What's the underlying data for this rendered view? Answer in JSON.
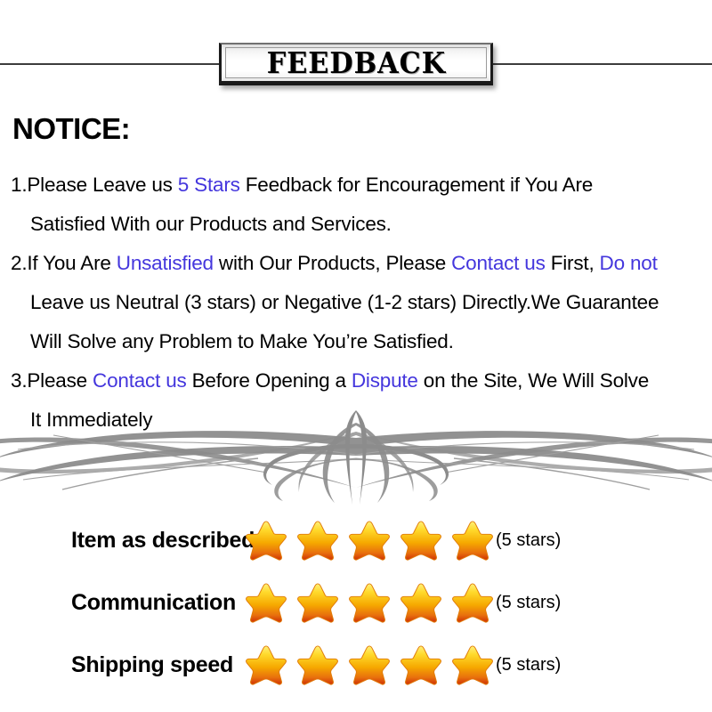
{
  "banner": {
    "title": "FEEDBACK"
  },
  "notice": {
    "heading": "NOTICE:",
    "highlight_color": "#4436dd",
    "lines": [
      {
        "indent": false,
        "parts": [
          {
            "text": "1.Please Leave us  ",
            "highlight": false
          },
          {
            "text": "5 Stars",
            "highlight": true
          },
          {
            "text": "  Feedback for  Encouragement  if You Are",
            "highlight": false
          }
        ]
      },
      {
        "indent": true,
        "parts": [
          {
            "text": "Satisfied With our Products and Services.",
            "highlight": false
          }
        ]
      },
      {
        "indent": false,
        "parts": [
          {
            "text": "2.If You Are ",
            "highlight": false
          },
          {
            "text": "Unsatisfied",
            "highlight": true
          },
          {
            "text": " with Our Products, Please ",
            "highlight": false
          },
          {
            "text": "Contact us",
            "highlight": true
          },
          {
            "text": " First, ",
            "highlight": false
          },
          {
            "text": "Do not",
            "highlight": true
          }
        ]
      },
      {
        "indent": true,
        "parts": [
          {
            "text": "Leave us Neutral (3 stars) or Negative (1-2 stars) Directly.We Guarantee",
            "highlight": false
          }
        ]
      },
      {
        "indent": true,
        "parts": [
          {
            "text": "Will Solve any Problem to Make You’re  Satisfied.",
            "highlight": false
          }
        ]
      },
      {
        "indent": false,
        "parts": [
          {
            "text": "3.Please ",
            "highlight": false
          },
          {
            "text": "Contact us",
            "highlight": true
          },
          {
            "text": " Before Opening a ",
            "highlight": false
          },
          {
            "text": "Dispute",
            "highlight": true
          },
          {
            "text": " on the Site, We Will Solve",
            "highlight": false
          }
        ]
      },
      {
        "indent": true,
        "parts": [
          {
            "text": "It Immediately",
            "highlight": false
          }
        ]
      }
    ]
  },
  "divider": {
    "icon": "ornamental-flourish-divider",
    "color": "#8c8c8c"
  },
  "ratings": {
    "star_icon": "star-icon",
    "star_colors": {
      "top": "#ffe24a",
      "mid": "#f5a800",
      "bottom": "#d63d0a"
    },
    "rows": [
      {
        "label": "Item as described",
        "stars": 5,
        "count_text": "(5 stars)"
      },
      {
        "label": "Communication",
        "stars": 5,
        "count_text": "(5 stars)"
      },
      {
        "label": "Shipping speed",
        "stars": 5,
        "count_text": "(5 stars)"
      }
    ]
  }
}
